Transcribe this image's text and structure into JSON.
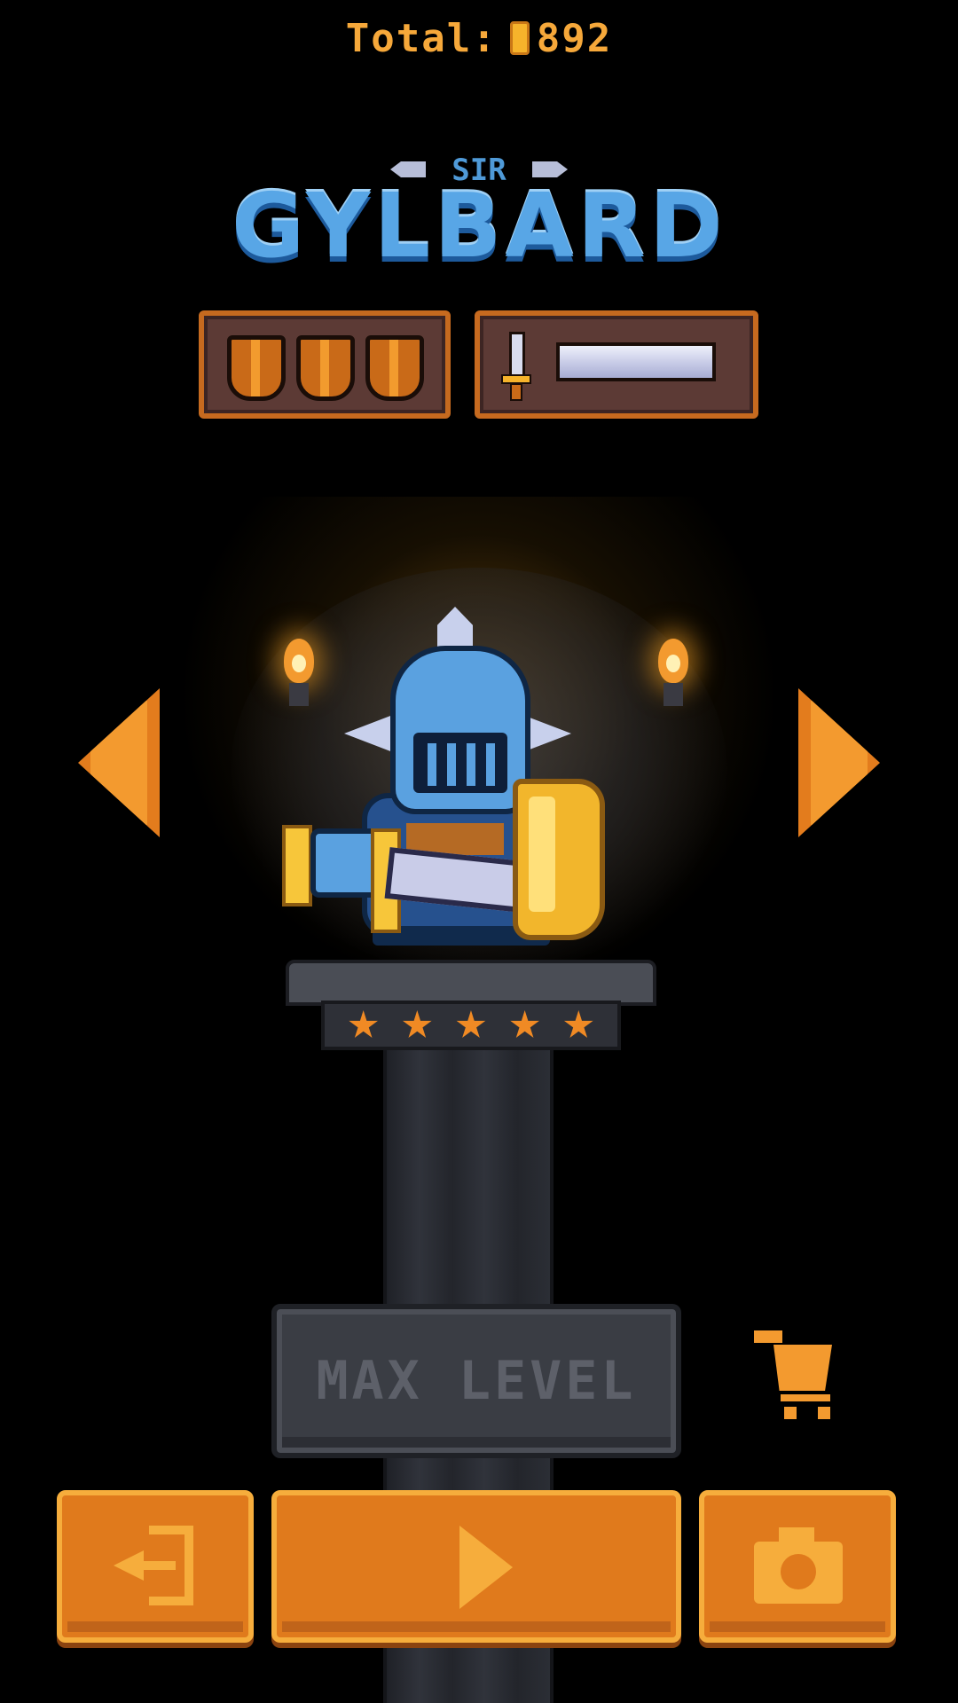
{
  "header": {
    "total_label": "Total:",
    "coins": "892",
    "coin_icon": "coin-icon"
  },
  "character": {
    "title_prefix": "SIR",
    "name": "GYLBARD",
    "defense_shields": 3,
    "attack_bar_fill": 1.0,
    "stars": 5
  },
  "buttons": {
    "max_level_label": "MAX LEVEL",
    "exit_icon": "exit-icon",
    "play_icon": "play-icon",
    "camera_icon": "camera-icon",
    "cart_icon": "cart-icon",
    "prev_icon": "arrow-left-icon",
    "next_icon": "arrow-right-icon"
  },
  "colors": {
    "accent_orange": "#e07a1c",
    "highlight_orange": "#f6ad3c",
    "title_blue": "#58a6e6",
    "disabled_gray": "#3a3d44"
  }
}
